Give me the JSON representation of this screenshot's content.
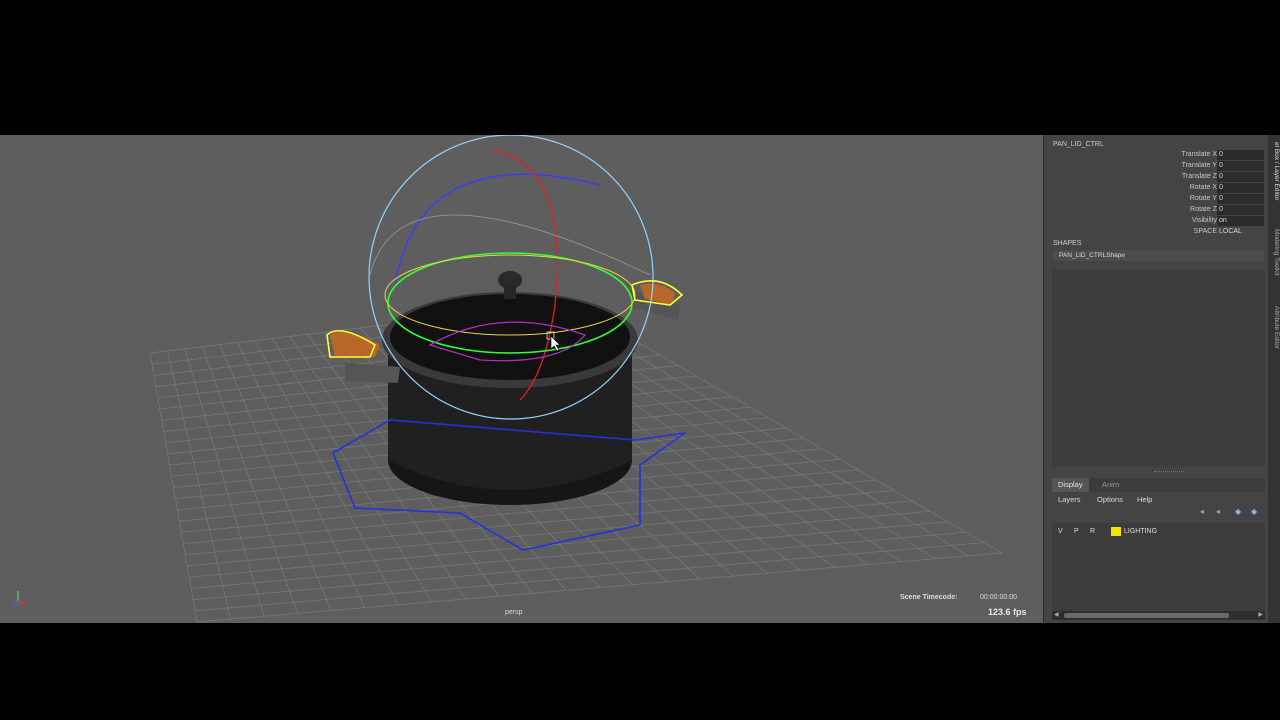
{
  "viewport": {
    "camera": "persp",
    "timecode_label": "Scene Timecode:",
    "timecode_value": "00:00:00:00",
    "fps": "123.6 fps"
  },
  "channel_box": {
    "object_name": "PAN_LID_CTRL",
    "attributes": [
      {
        "label": "Translate X",
        "value": "0"
      },
      {
        "label": "Translate Y",
        "value": "0"
      },
      {
        "label": "Translate Z",
        "value": "0"
      },
      {
        "label": "Rotate X",
        "value": "0"
      },
      {
        "label": "Rotate Y",
        "value": "0"
      },
      {
        "label": "Rotate Z",
        "value": "0"
      },
      {
        "label": "Visibility",
        "value": "on"
      },
      {
        "label": "SPACE",
        "value": "LOCAL"
      }
    ],
    "shapes_title": "SHAPES",
    "shape_item": "PAN_LID_CTRLShape"
  },
  "layer_editor": {
    "tabs": [
      "Display",
      "Anim"
    ],
    "menu": [
      "Layers",
      "Options",
      "Help"
    ],
    "layers": [
      {
        "v": "V",
        "p": "P",
        "r": "R",
        "color": "#f2e600",
        "name": "LIGHTING"
      }
    ]
  },
  "side_tabs": [
    "el Box / Layer Editor",
    "Modeling Toolkit",
    "Attribute Editor"
  ]
}
